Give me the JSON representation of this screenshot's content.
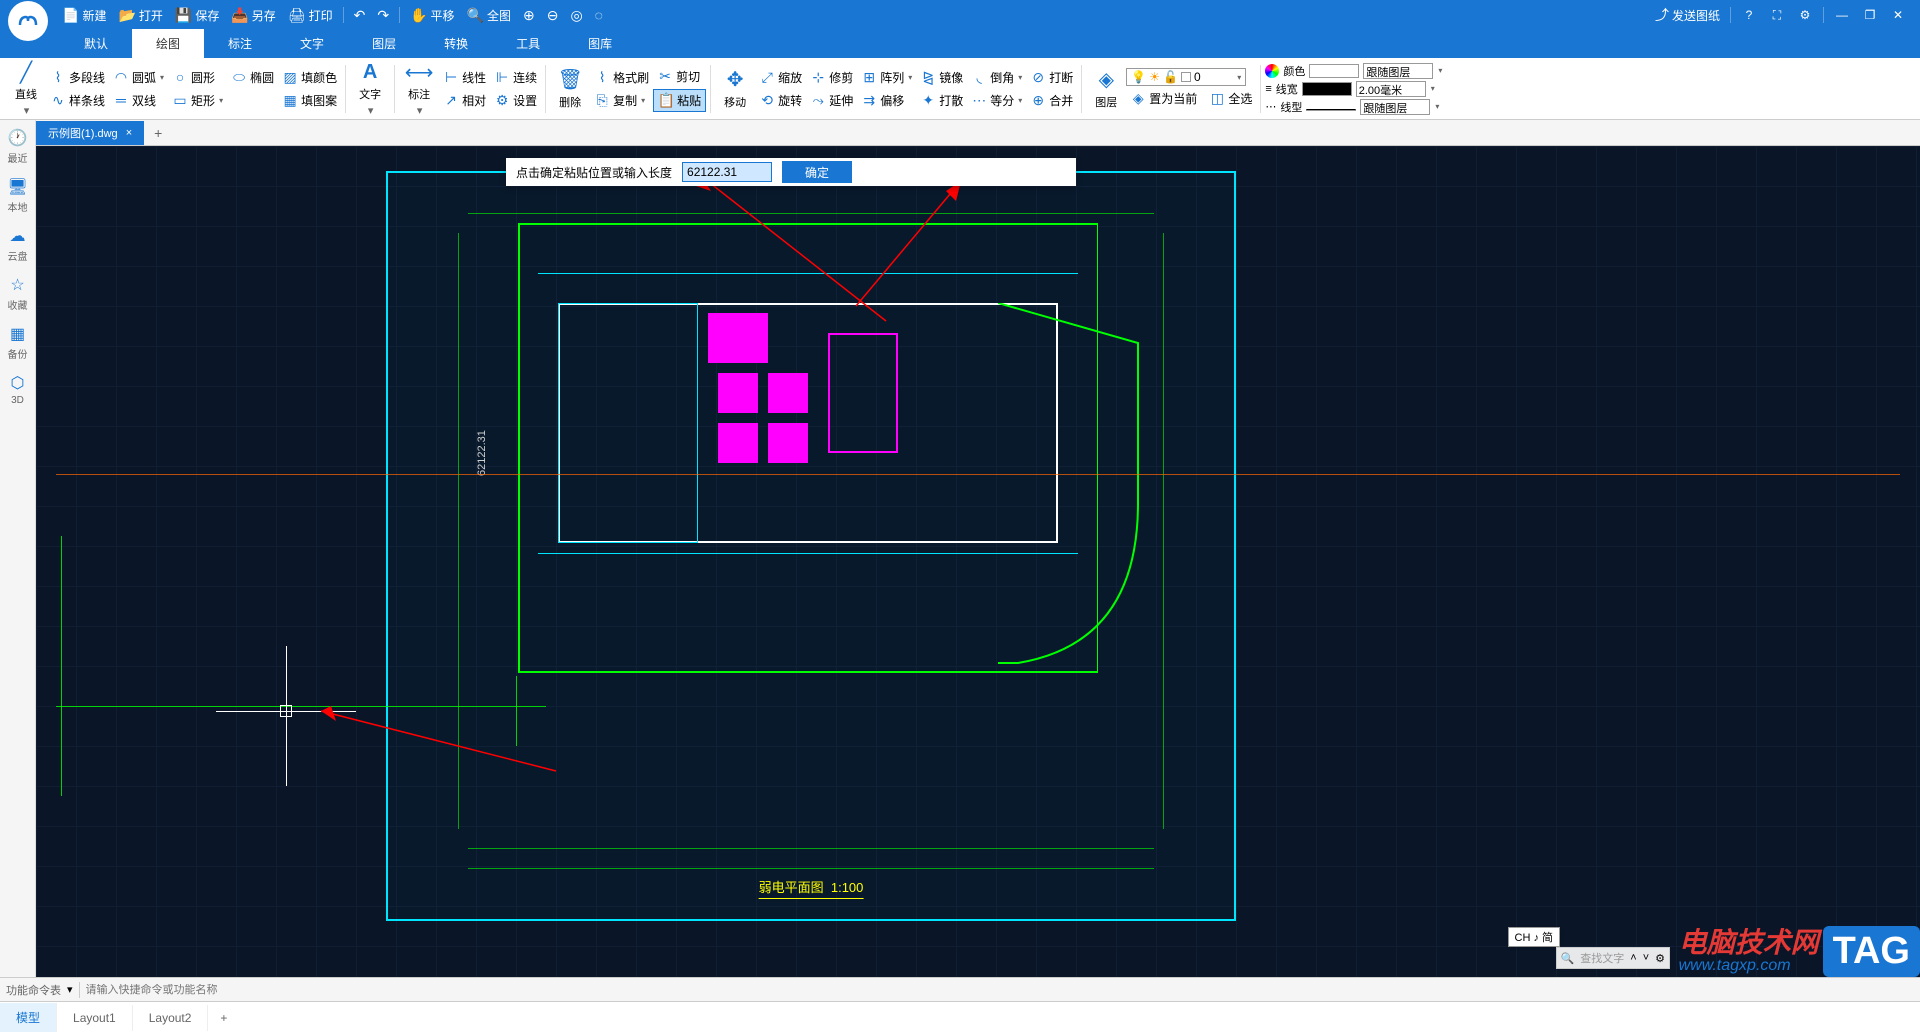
{
  "titlebar": {
    "new": "新建",
    "open": "打开",
    "save": "保存",
    "saveas": "另存",
    "print": "打印",
    "pan": "平移",
    "fit": "全图",
    "send": "发送图纸"
  },
  "menutabs": [
    "默认",
    "绘图",
    "标注",
    "文字",
    "图层",
    "转换",
    "工具",
    "图库"
  ],
  "menutabs_active": 1,
  "ribbon": {
    "line": "直线",
    "polyline": "多段线",
    "spline": "样条线",
    "arc": "圆弧",
    "dline": "双线",
    "circle": "圆形",
    "rect": "矩形",
    "ellipse": "椭圆",
    "fillcolor": "填颜色",
    "fillpattern": "填图案",
    "text": "文字",
    "dim": "标注",
    "linear": "线性",
    "relative": "相对",
    "continuous": "连续",
    "settings": "设置",
    "delete": "删除",
    "format": "格式刷",
    "copy": "复制",
    "cut": "剪切",
    "paste": "粘贴",
    "move": "移动",
    "scale": "缩放",
    "rotate": "旋转",
    "trim": "修剪",
    "extend": "延伸",
    "array": "阵列",
    "offset": "偏移",
    "mirror": "镜像",
    "explode": "打散",
    "fillet": "倒角",
    "divide": "等分",
    "break": "打断",
    "join": "合并",
    "layer": "图层",
    "layer_val": "0",
    "setcurrent": "置为当前",
    "selectall": "全选",
    "color": "颜色",
    "linewidth": "线宽",
    "linetype": "线型",
    "follow_layer": "跟随图层",
    "lw_val": "2.00毫米"
  },
  "sidebar": [
    {
      "icon": "🕐",
      "label": "最近"
    },
    {
      "icon": "🖥",
      "label": "本地"
    },
    {
      "icon": "☁",
      "label": "云盘"
    },
    {
      "icon": "☆",
      "label": "收藏"
    },
    {
      "icon": "▦",
      "label": "备份"
    },
    {
      "icon": "⬡",
      "label": "3D"
    }
  ],
  "filetab": "示例图(1).dwg",
  "prompt": {
    "text": "点击确定粘贴位置或输入长度",
    "value": "62122.31",
    "ok": "确定"
  },
  "drawing": {
    "title": "弱电平面图",
    "scale": "1:100",
    "dim_value": "62122.31"
  },
  "search": {
    "placeholder": "查找文字",
    "ime": "CH ♪ 简"
  },
  "cmdbar": {
    "label": "功能命令表",
    "placeholder": "请输入快捷命令或功能名称"
  },
  "layouttabs": [
    "模型",
    "Layout1",
    "Layout2"
  ],
  "layouttabs_active": 0,
  "watermark": {
    "cn": "电脑技术网",
    "url": "www.tagxp.com",
    "tag": "TAG"
  }
}
